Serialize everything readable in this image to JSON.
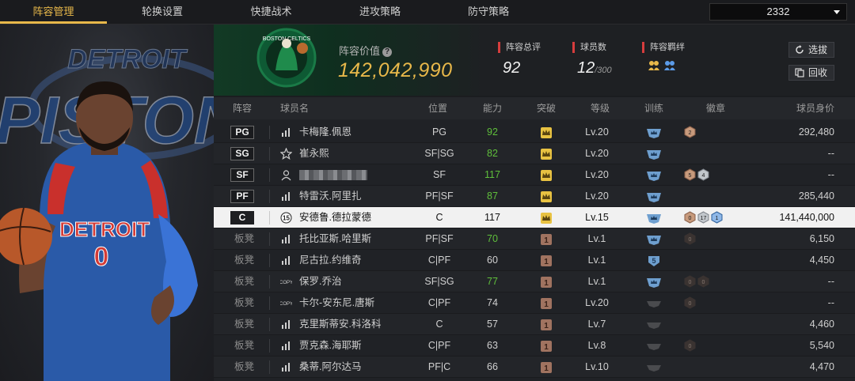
{
  "nav": {
    "tabs": [
      "阵容管理",
      "轮换设置",
      "快捷战术",
      "进攻策略",
      "防守策略"
    ],
    "active_tab": 0,
    "season_value": "2332"
  },
  "header": {
    "value_label": "阵容价值",
    "value": "142,042,990",
    "overall_label": "阵容总评",
    "overall_value": "92",
    "count_label": "球员数",
    "count_value": "12",
    "count_max": "/300",
    "bond_label": "阵容羁绊",
    "buttons": {
      "pick": "选拔",
      "recall": "回收"
    }
  },
  "columns": [
    "阵容",
    "球员名",
    "位置",
    "能力",
    "突破",
    "等级",
    "训练",
    "徽章",
    "球员身价"
  ],
  "colors": {
    "accent": "#e8b84a",
    "green": "#5fbf3b",
    "red": "#d63d3d"
  },
  "players": [
    {
      "slot": "PG",
      "starter": true,
      "icon": "bar-chart-icon",
      "name": "卡梅隆.佩恩",
      "pos": "PG",
      "ability": "92",
      "ability_green": true,
      "breakthrough": "crown-gold",
      "level": "Lv.20",
      "training": "crown-shield-blue",
      "badges": [
        {
          "t": "2",
          "c": "bronze"
        }
      ],
      "price": "292,480"
    },
    {
      "slot": "SG",
      "starter": true,
      "icon": "star-outline-icon",
      "name": "崔永熙",
      "pos": "SF|SG",
      "ability": "82",
      "ability_green": true,
      "breakthrough": "crown-gold",
      "level": "Lv.20",
      "training": "crown-shield-blue",
      "badges": [],
      "price": "--"
    },
    {
      "slot": "SF",
      "starter": true,
      "icon": "person-icon",
      "name": "",
      "pos": "SF",
      "ability": "117",
      "ability_green": true,
      "breakthrough": "crown-gold",
      "level": "Lv.20",
      "training": "crown-shield-blue",
      "badges": [
        {
          "t": "5",
          "c": "bronze"
        },
        {
          "t": "4",
          "c": "silver"
        }
      ],
      "price": "--"
    },
    {
      "slot": "PF",
      "starter": true,
      "icon": "bar-chart-icon",
      "name": "特雷沃.阿里扎",
      "pos": "PF|SF",
      "ability": "87",
      "ability_green": true,
      "breakthrough": "crown-gold",
      "level": "Lv.20",
      "training": "crown-shield-blue",
      "badges": [],
      "price": "285,440"
    },
    {
      "slot": "C",
      "starter": true,
      "selected": true,
      "icon": "jersey-15-icon",
      "name": "安德鲁.德拉蒙德",
      "pos": "C",
      "ability": "117",
      "ability_green": false,
      "breakthrough": "crown-gold",
      "level": "Lv.15",
      "training": "crown-shield-blue",
      "badges": [
        {
          "t": "0",
          "c": "bronze"
        },
        {
          "t": "17",
          "c": "silver"
        },
        {
          "t": "1",
          "c": "blue"
        }
      ],
      "price": "141,440,000"
    },
    {
      "slot": "板凳",
      "starter": false,
      "icon": "bar-chart-icon",
      "name": "托比亚斯.哈里斯",
      "pos": "PF|SF",
      "ability": "70",
      "ability_green": true,
      "breakthrough": "brown-1",
      "level": "Lv.1",
      "training": "crown-shield-blue",
      "badges": [
        {
          "t": "0",
          "c": "dark"
        }
      ],
      "price": "6,150"
    },
    {
      "slot": "板凳",
      "starter": false,
      "icon": "bar-chart-icon",
      "name": "尼古拉.约维奇",
      "pos": "C|PF",
      "ability": "60",
      "ability_green": false,
      "breakthrough": "brown-1",
      "level": "Lv.1",
      "training": "shield-5-blue",
      "badges": [],
      "price": "4,450"
    },
    {
      "slot": "板凳",
      "starter": false,
      "icon": "copy-icon",
      "name": "保罗.乔治",
      "pos": "SF|SG",
      "ability": "77",
      "ability_green": true,
      "breakthrough": "brown-1",
      "level": "Lv.1",
      "training": "crown-shield-blue",
      "badges": [
        {
          "t": "0",
          "c": "dark"
        },
        {
          "t": "0",
          "c": "dark"
        }
      ],
      "price": "--"
    },
    {
      "slot": "板凳",
      "starter": false,
      "icon": "copy-icon",
      "name": "卡尔-安东尼.唐斯",
      "pos": "C|PF",
      "ability": "74",
      "ability_green": false,
      "breakthrough": "brown-1",
      "level": "Lv.20",
      "training": "gray-diamond",
      "badges": [
        {
          "t": "0",
          "c": "dark"
        }
      ],
      "price": "--"
    },
    {
      "slot": "板凳",
      "starter": false,
      "icon": "bar-chart-icon",
      "name": "克里斯蒂安.科洛科",
      "pos": "C",
      "ability": "57",
      "ability_green": false,
      "breakthrough": "brown-1",
      "level": "Lv.7",
      "training": "gray-diamond",
      "badges": [],
      "price": "4,460"
    },
    {
      "slot": "板凳",
      "starter": false,
      "icon": "bar-chart-icon",
      "name": "贾克森.海耶斯",
      "pos": "C|PF",
      "ability": "63",
      "ability_green": false,
      "breakthrough": "brown-1",
      "level": "Lv.8",
      "training": "gray-diamond",
      "badges": [
        {
          "t": "0",
          "c": "dark"
        }
      ],
      "price": "5,540"
    },
    {
      "slot": "板凳",
      "starter": false,
      "icon": "bar-chart-icon",
      "name": "桑蒂.阿尔达马",
      "pos": "PF|C",
      "ability": "66",
      "ability_green": false,
      "breakthrough": "brown-1",
      "level": "Lv.10",
      "training": "gray-diamond",
      "badges": [],
      "price": "4,470"
    }
  ]
}
